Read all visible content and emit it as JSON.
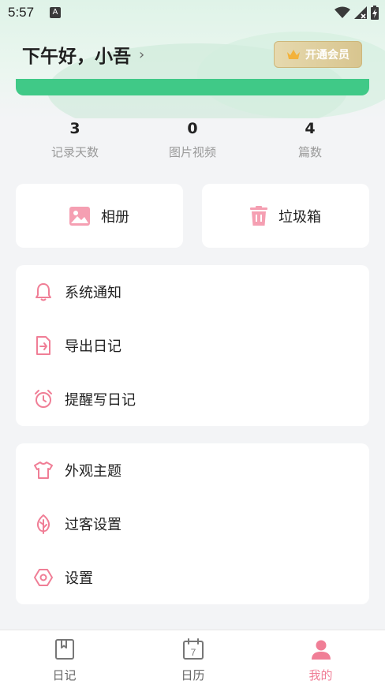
{
  "status_bar": {
    "time": "5:57",
    "notification_letter": "A"
  },
  "header": {
    "greeting": "下午好，小吾",
    "chevron": "›",
    "vip_button": "开通会员"
  },
  "stats": [
    {
      "value": "3",
      "label": "记录天数"
    },
    {
      "value": "0",
      "label": "图片视频"
    },
    {
      "value": "4",
      "label": "篇数"
    }
  ],
  "quick_actions": [
    {
      "label": "相册",
      "icon": "photo-album-icon"
    },
    {
      "label": "垃圾箱",
      "icon": "trash-icon"
    }
  ],
  "menu_group_1": [
    {
      "label": "系统通知",
      "icon": "bell-icon"
    },
    {
      "label": "导出日记",
      "icon": "export-icon"
    },
    {
      "label": "提醒写日记",
      "icon": "alarm-clock-icon"
    }
  ],
  "menu_group_2": [
    {
      "label": "外观主题",
      "icon": "tshirt-icon"
    },
    {
      "label": "过客设置",
      "icon": "leaf-icon"
    },
    {
      "label": "设置",
      "icon": "hexagon-settings-icon"
    }
  ],
  "tabs": [
    {
      "label": "日记",
      "icon": "diary-book-icon",
      "active": false
    },
    {
      "label": "日历",
      "icon": "calendar-icon",
      "calendar_day": "7",
      "active": false
    },
    {
      "label": "我的",
      "icon": "user-icon",
      "active": true
    }
  ],
  "colors": {
    "accent_pink": "#f07e96",
    "accent_green": "#40c987",
    "vip_gold": "#d8c58f",
    "background": "#f3f4f6"
  }
}
